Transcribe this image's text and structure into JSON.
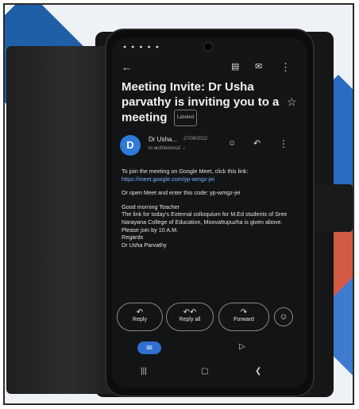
{
  "email": {
    "subject": "Meeting Invite: Dr Usha parvathy is inviting you to a meeting",
    "label_tag": "Labeled",
    "sender_initial": "D",
    "sender_name": "Dr Usha...",
    "sender_date": "27/08/2022",
    "recipient": "to archfaslsvu2",
    "body_line1": "To join the meeting on Google Meet, click this link:",
    "meet_link": "https://meet.google.com/yp-wmgz-jei",
    "body_line2": "Or open Meet and enter this code: yp-wmgz-jei",
    "greeting": "Good morning Teacher",
    "message": "The link for today's External colloquium for M.Ed students of Sree Narayana College of Education, Moovattupuzha is given above. Please join by 10 A.M.",
    "regards": "Regards",
    "signature": "Dr Usha Parvathy"
  },
  "actions": {
    "reply": "Reply",
    "reply_all": "Reply all",
    "forward": "Forward"
  },
  "icons": {
    "back": "back-arrow-icon",
    "archive": "archive-icon",
    "mail": "mail-icon",
    "more": "more-vert-icon",
    "star": "star-icon",
    "reply": "reply-icon",
    "emoji": "emoji-icon",
    "meet": "video-icon"
  },
  "colors": {
    "accent": "#2f6fd0",
    "link": "#7fb2ff",
    "screen_bg": "#121416"
  }
}
